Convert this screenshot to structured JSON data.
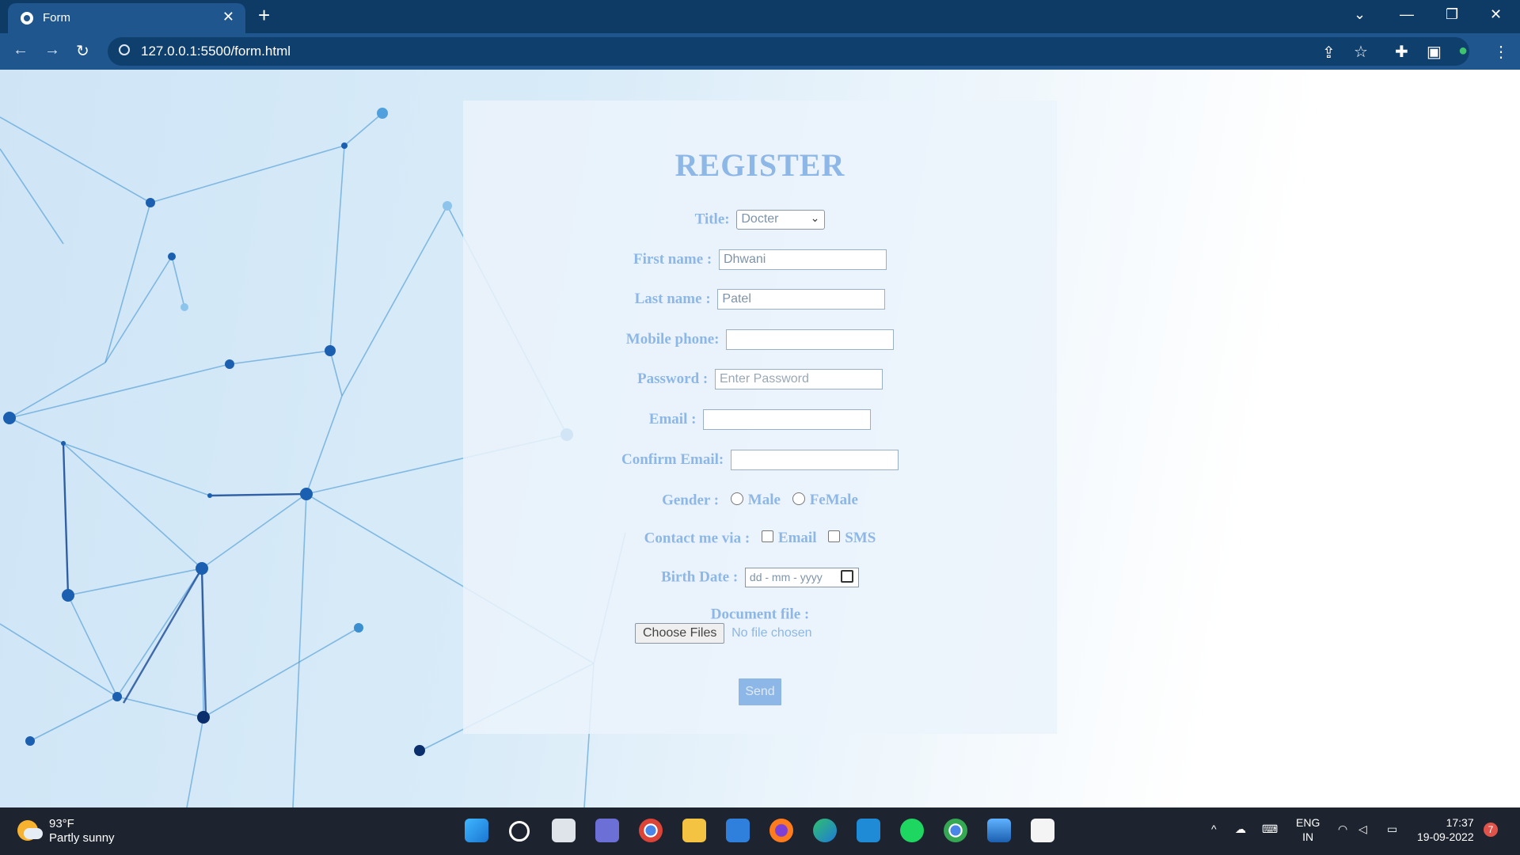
{
  "browser": {
    "tab_title": "Form",
    "url": "127.0.0.1:5500/form.html"
  },
  "form": {
    "heading": "REGISTER",
    "title_label": "Title:",
    "title_value": "Docter",
    "first_name_label": "First name :",
    "first_name_value": "Dhwani",
    "last_name_label": "Last name :",
    "last_name_value": "Patel",
    "mobile_label": "Mobile phone:",
    "password_label": "Password :",
    "password_placeholder": "Enter Password",
    "email_label": "Email :",
    "confirm_email_label": "Confirm Email:",
    "gender_label": "Gender :",
    "gender_options": [
      "Male",
      "FeMale"
    ],
    "contact_label": "Contact me via :",
    "contact_options": [
      "Email",
      "SMS"
    ],
    "birth_label": "Birth Date :",
    "birth_placeholder": "dd - mm - yyyy",
    "document_label": "Document file :",
    "choose_files": "Choose Files",
    "no_file": "No file chosen",
    "send": "Send"
  },
  "taskbar": {
    "temperature": "93°F",
    "weather": "Partly sunny",
    "lang_1": "ENG",
    "lang_2": "IN",
    "time": "17:37",
    "date": "19-09-2022",
    "notifications": "7"
  },
  "colors": {
    "chrome_dark": "#0e3a66",
    "chrome": "#1e568d",
    "form_text": "#8db7e6",
    "taskbar": "#1d2430"
  }
}
